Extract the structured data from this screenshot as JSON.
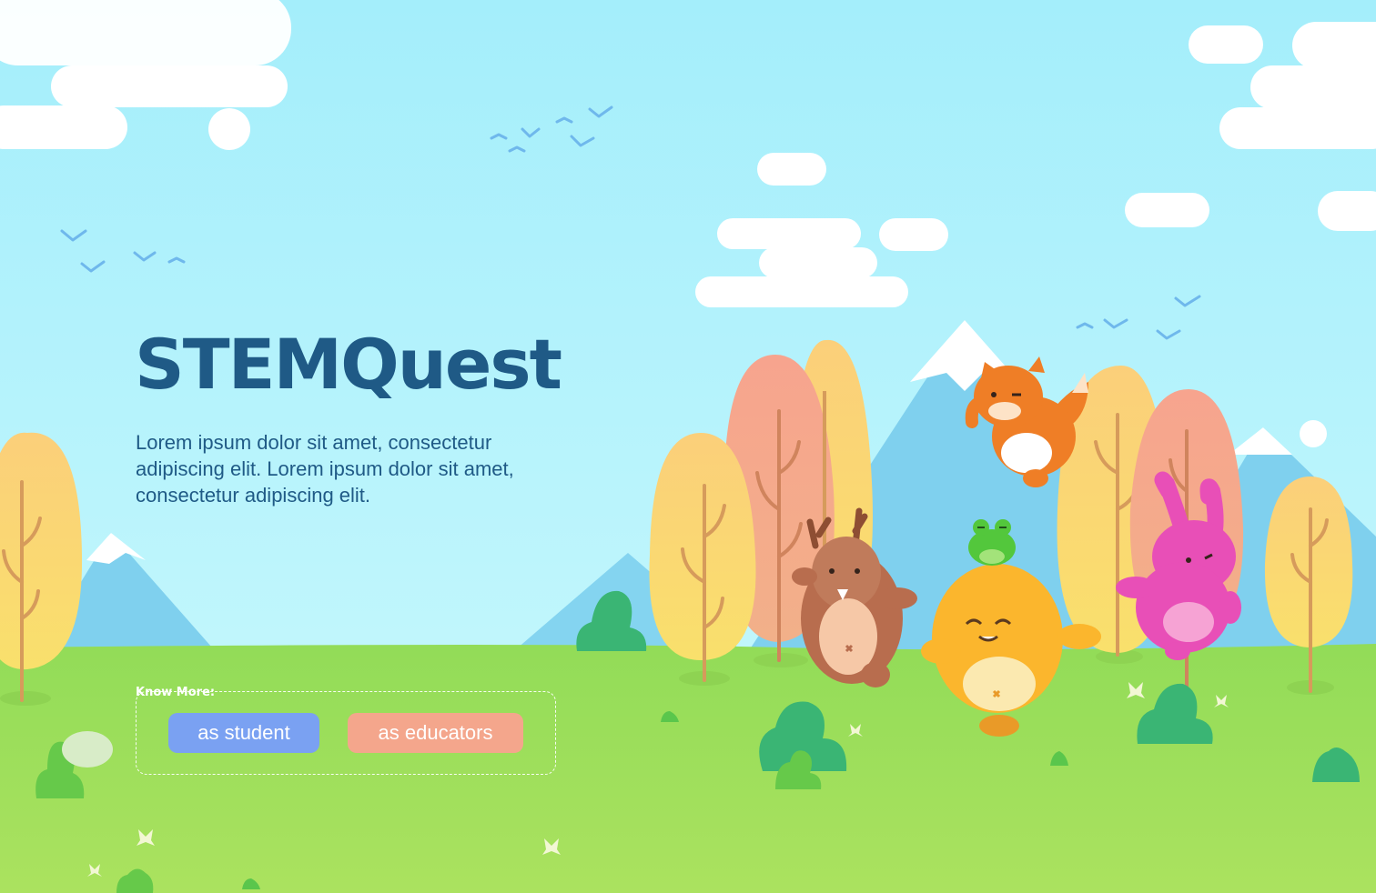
{
  "hero": {
    "title": "STEMQuest",
    "description": "Lorem ipsum dolor sit amet, consectetur adipiscing elit. Lorem ipsum dolor sit amet, consectetur adipiscing elit."
  },
  "cta": {
    "label": "Know More:",
    "buttons": [
      {
        "label": "as student",
        "color": "#7aa1f2"
      },
      {
        "label": "as educators",
        "color": "#f4a68c"
      }
    ]
  },
  "illustration": {
    "characters": [
      "deer",
      "fox",
      "frog",
      "beaver",
      "bunny"
    ],
    "colors": {
      "sky_top": "#a6f0fc",
      "sky_bottom": "#c8f8fd",
      "grass": "#a6e05c",
      "title": "#1f5a86"
    }
  }
}
